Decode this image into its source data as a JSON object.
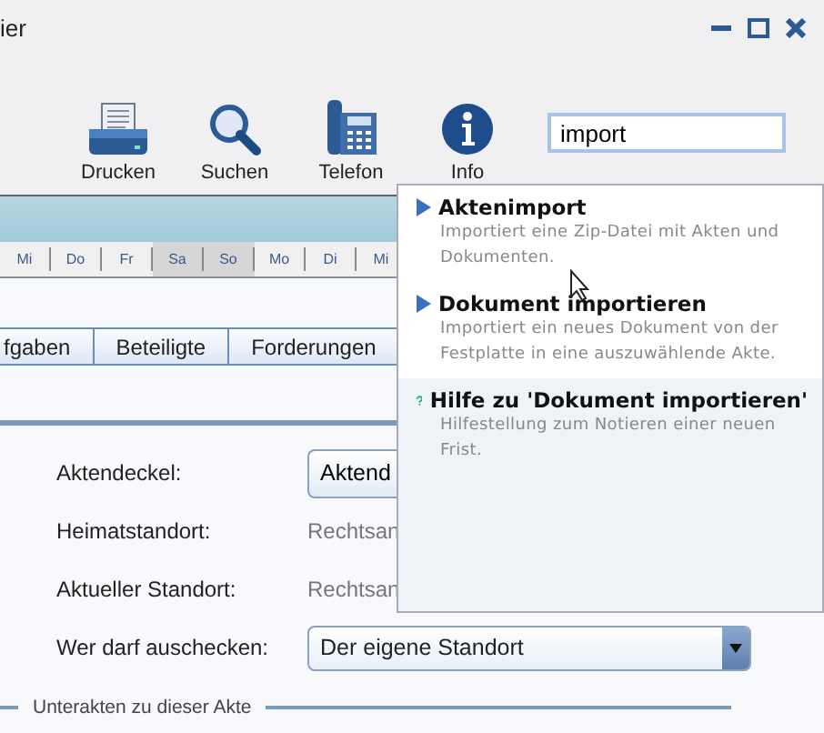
{
  "window": {
    "title": "ier"
  },
  "toolbar": {
    "buttons": [
      {
        "kind": "print",
        "label": "Drucken"
      },
      {
        "kind": "search",
        "label": "Suchen"
      },
      {
        "kind": "phone",
        "label": "Telefon"
      },
      {
        "kind": "info",
        "label": "Info"
      }
    ],
    "search": {
      "value": "import"
    }
  },
  "calendar": {
    "days": [
      {
        "label": "Mi",
        "weekend": false
      },
      {
        "label": "Do",
        "weekend": false
      },
      {
        "label": "Fr",
        "weekend": false
      },
      {
        "label": "Sa",
        "weekend": true
      },
      {
        "label": "So",
        "weekend": true
      },
      {
        "label": "Mo",
        "weekend": false
      },
      {
        "label": "Di",
        "weekend": false
      },
      {
        "label": "Mi",
        "weekend": false
      }
    ]
  },
  "tabs": [
    "fgaben",
    "Beteiligte",
    "Forderungen"
  ],
  "form": {
    "rows": [
      {
        "kind": "button",
        "label": "Aktendeckel:",
        "value": "Aktend"
      },
      {
        "kind": "text",
        "label": "Heimatstandort:",
        "value": "Rechtsan"
      },
      {
        "kind": "text",
        "label": "Aktueller Standort:",
        "value": "Rechtsan"
      },
      {
        "kind": "select",
        "label": "Wer darf auschecken:",
        "value": "Der eigene Standort"
      }
    ],
    "section": "Unterakten zu dieser Akte"
  },
  "suggestions": [
    {
      "kind": "action",
      "title": "Aktenimport",
      "description": "Importiert eine Zip-Datei mit Akten und Dokumenten.",
      "selected": false
    },
    {
      "kind": "action",
      "title": "Dokument importieren",
      "description": "Importiert ein neues Dokument von der Festplatte in eine auszuwählende Akte.",
      "selected": false
    },
    {
      "kind": "help",
      "title": "Hilfe zu 'Dokument importieren'",
      "description": "Hilfestellung zum Notieren einer neuen Frist.",
      "selected": true
    }
  ]
}
